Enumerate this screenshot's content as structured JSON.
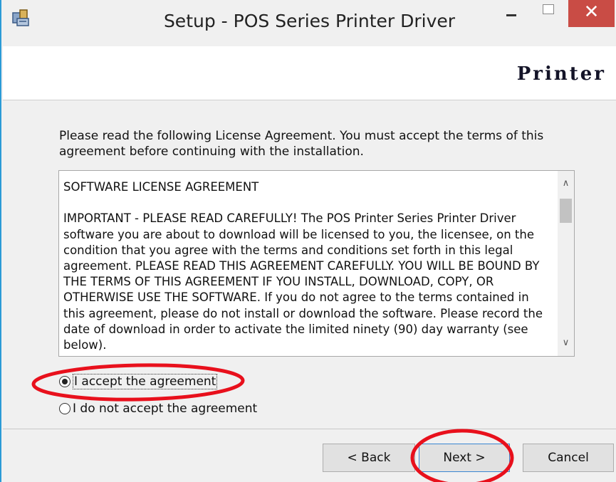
{
  "window": {
    "title": "Setup - POS Series Printer Driver",
    "close_glyph": "✕"
  },
  "header": {
    "brand": "Printer"
  },
  "intro": "Please read the following License Agreement. You must accept the terms of this agreement before continuing with the installation.",
  "license": {
    "text": "SOFTWARE LICENSE AGREEMENT\n\nIMPORTANT - PLEASE READ CAREFULLY!  The POS Printer Series Printer Driver software you are about to download will be licensed to you, the licensee, on the condition that you agree with the terms and conditions set forth in this legal agreement.  PLEASE READ THIS AGREEMENT CAREFULLY.  YOU WILL BE BOUND BY THE TERMS OF THIS AGREEMENT IF YOU INSTALL, DOWNLOAD, COPY, OR OTHERWISE USE THE SOFTWARE. If you do not agree to the terms contained in this agreement, please do not install or download the software.  Please record the date of download in order to activate the limited ninety (90) day warranty (see below)."
  },
  "options": {
    "accept": "I accept the agreement",
    "decline": "I do not accept the agreement",
    "selected": "accept"
  },
  "buttons": {
    "back": "< Back",
    "next": "Next >",
    "cancel": "Cancel"
  },
  "colors": {
    "annotation": "#e8101c",
    "close_button": "#c94c45",
    "border_accent": "#2b9bd6"
  },
  "icons": [
    "setup-app-icon",
    "minimize-icon",
    "maximize-icon",
    "close-icon",
    "scroll-up-arrow-icon",
    "scroll-down-arrow-icon"
  ]
}
